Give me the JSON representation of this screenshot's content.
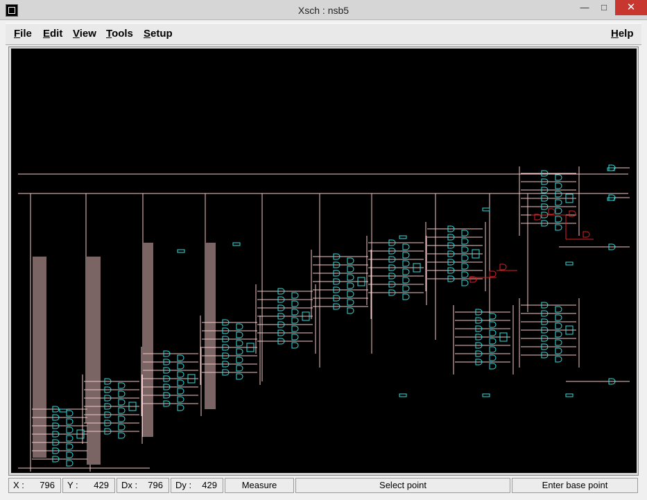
{
  "window": {
    "title": "Xsch : nsb5",
    "minimize": "—",
    "maximize": "□",
    "close": "✕"
  },
  "menu": {
    "file": {
      "key": "F",
      "rest": "ile"
    },
    "edit": {
      "key": "E",
      "rest": "dit"
    },
    "view": {
      "key": "V",
      "rest": "iew"
    },
    "tools": {
      "key": "T",
      "rest": "ools"
    },
    "setup": {
      "key": "S",
      "rest": "etup"
    },
    "help": {
      "key": "H",
      "rest": "elp"
    }
  },
  "status": {
    "x_label": "X :",
    "x_value": "796",
    "y_label": "Y :",
    "y_value": "429",
    "dx_label": "Dx :",
    "dx_value": "796",
    "dy_label": "Dy :",
    "dy_value": "429",
    "mode": "Measure",
    "prompt": "Select point",
    "hint": "Enter base point"
  },
  "colors": {
    "wire": "#f4c8c8",
    "gate": "#30e0e0",
    "highlight": "#e02020",
    "background": "#000000"
  },
  "icons": {
    "app": "xsch-app-icon"
  }
}
